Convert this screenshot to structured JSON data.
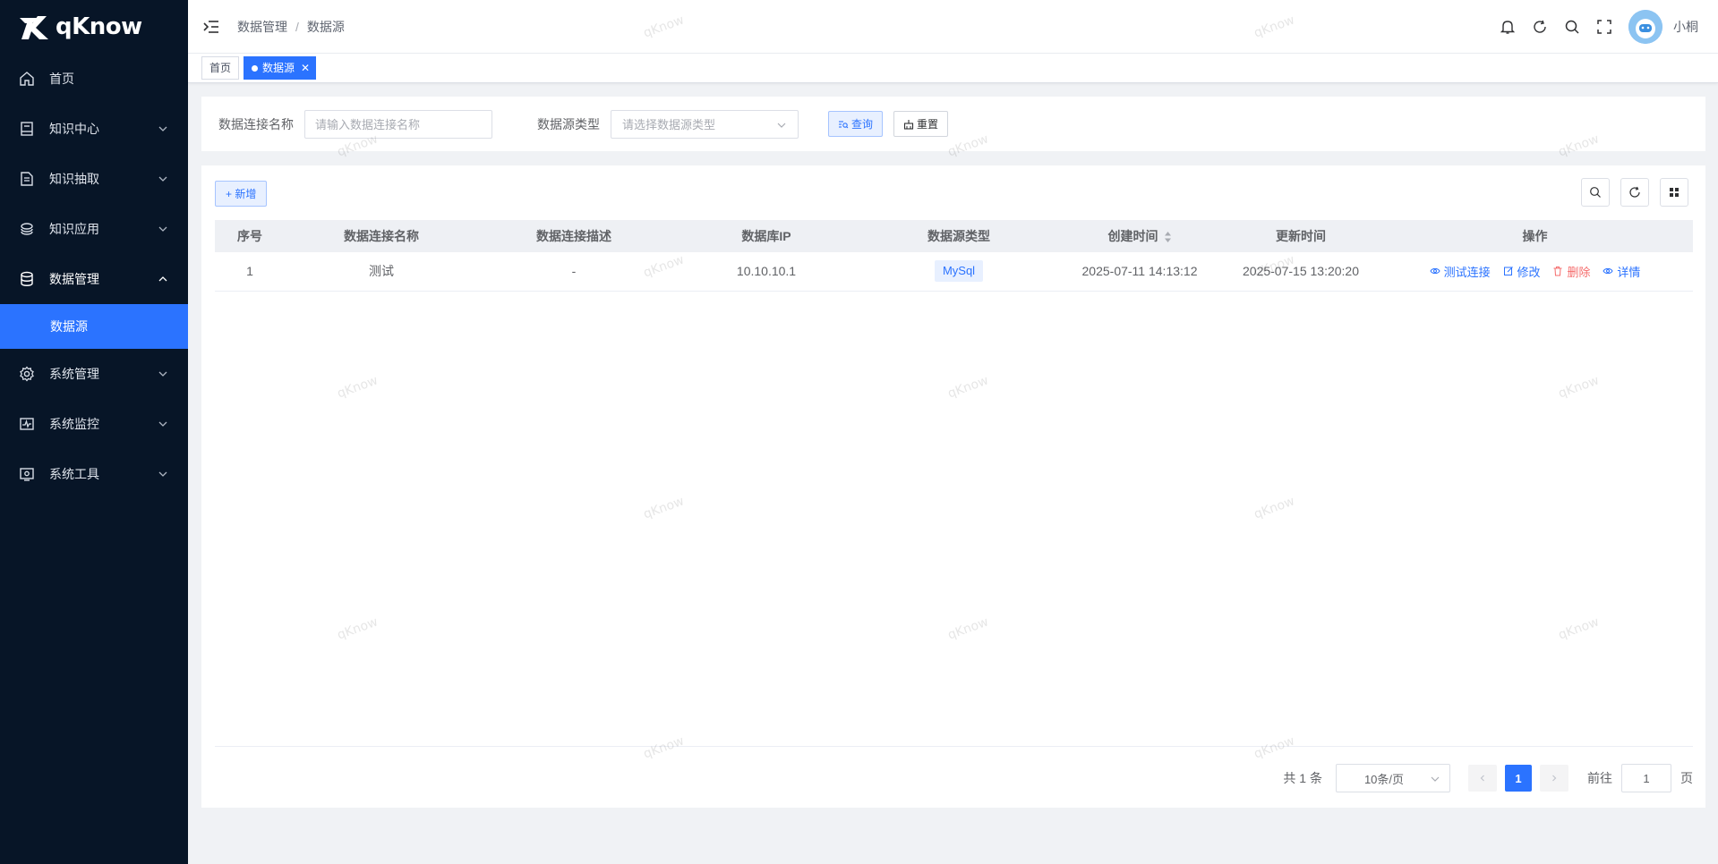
{
  "app": {
    "logo_text": "qKnow"
  },
  "sidebar": {
    "items": [
      {
        "label": "首页",
        "icon": "home-icon"
      },
      {
        "label": "知识中心",
        "icon": "book-icon"
      },
      {
        "label": "知识抽取",
        "icon": "document-icon"
      },
      {
        "label": "知识应用",
        "icon": "stack-icon"
      },
      {
        "label": "数据管理",
        "icon": "database-icon"
      },
      {
        "label": "系统管理",
        "icon": "gear-icon"
      },
      {
        "label": "系统监控",
        "icon": "monitor-pulse-icon"
      },
      {
        "label": "系统工具",
        "icon": "toolbox-icon"
      }
    ],
    "active_sub": "数据源"
  },
  "header": {
    "breadcrumb": [
      "数据管理",
      "数据源"
    ],
    "username": "小桐"
  },
  "tags": {
    "home": "首页",
    "active": "数据源"
  },
  "search": {
    "name_label": "数据连接名称",
    "name_placeholder": "请输入数据连接名称",
    "type_label": "数据源类型",
    "type_placeholder": "请选择数据源类型",
    "query_label": "查询",
    "reset_label": "重置"
  },
  "toolbar": {
    "add_label": "+ 新增"
  },
  "table": {
    "columns": [
      "序号",
      "数据连接名称",
      "数据连接描述",
      "数据库IP",
      "数据源类型",
      "创建时间",
      "更新时间",
      "操作"
    ],
    "rows": [
      {
        "index": "1",
        "name": "测试",
        "desc": "-",
        "ip": "10.10.10.1",
        "type": "MySql",
        "created": "2025-07-11 14:13:12",
        "updated": "2025-07-15 13:20:20"
      }
    ],
    "actions": {
      "test": "测试连接",
      "edit": "修改",
      "delete": "删除",
      "detail": "详情"
    }
  },
  "pagination": {
    "total_text": "共 1 条",
    "page_size": "10条/页",
    "current_page": "1",
    "goto_label": "前往",
    "goto_value": "1",
    "page_suffix": "页"
  },
  "watermark": "qKnow",
  "colors": {
    "primary": "#2b73ff",
    "sidebar_bg": "#071527",
    "danger": "#f56c6c"
  }
}
